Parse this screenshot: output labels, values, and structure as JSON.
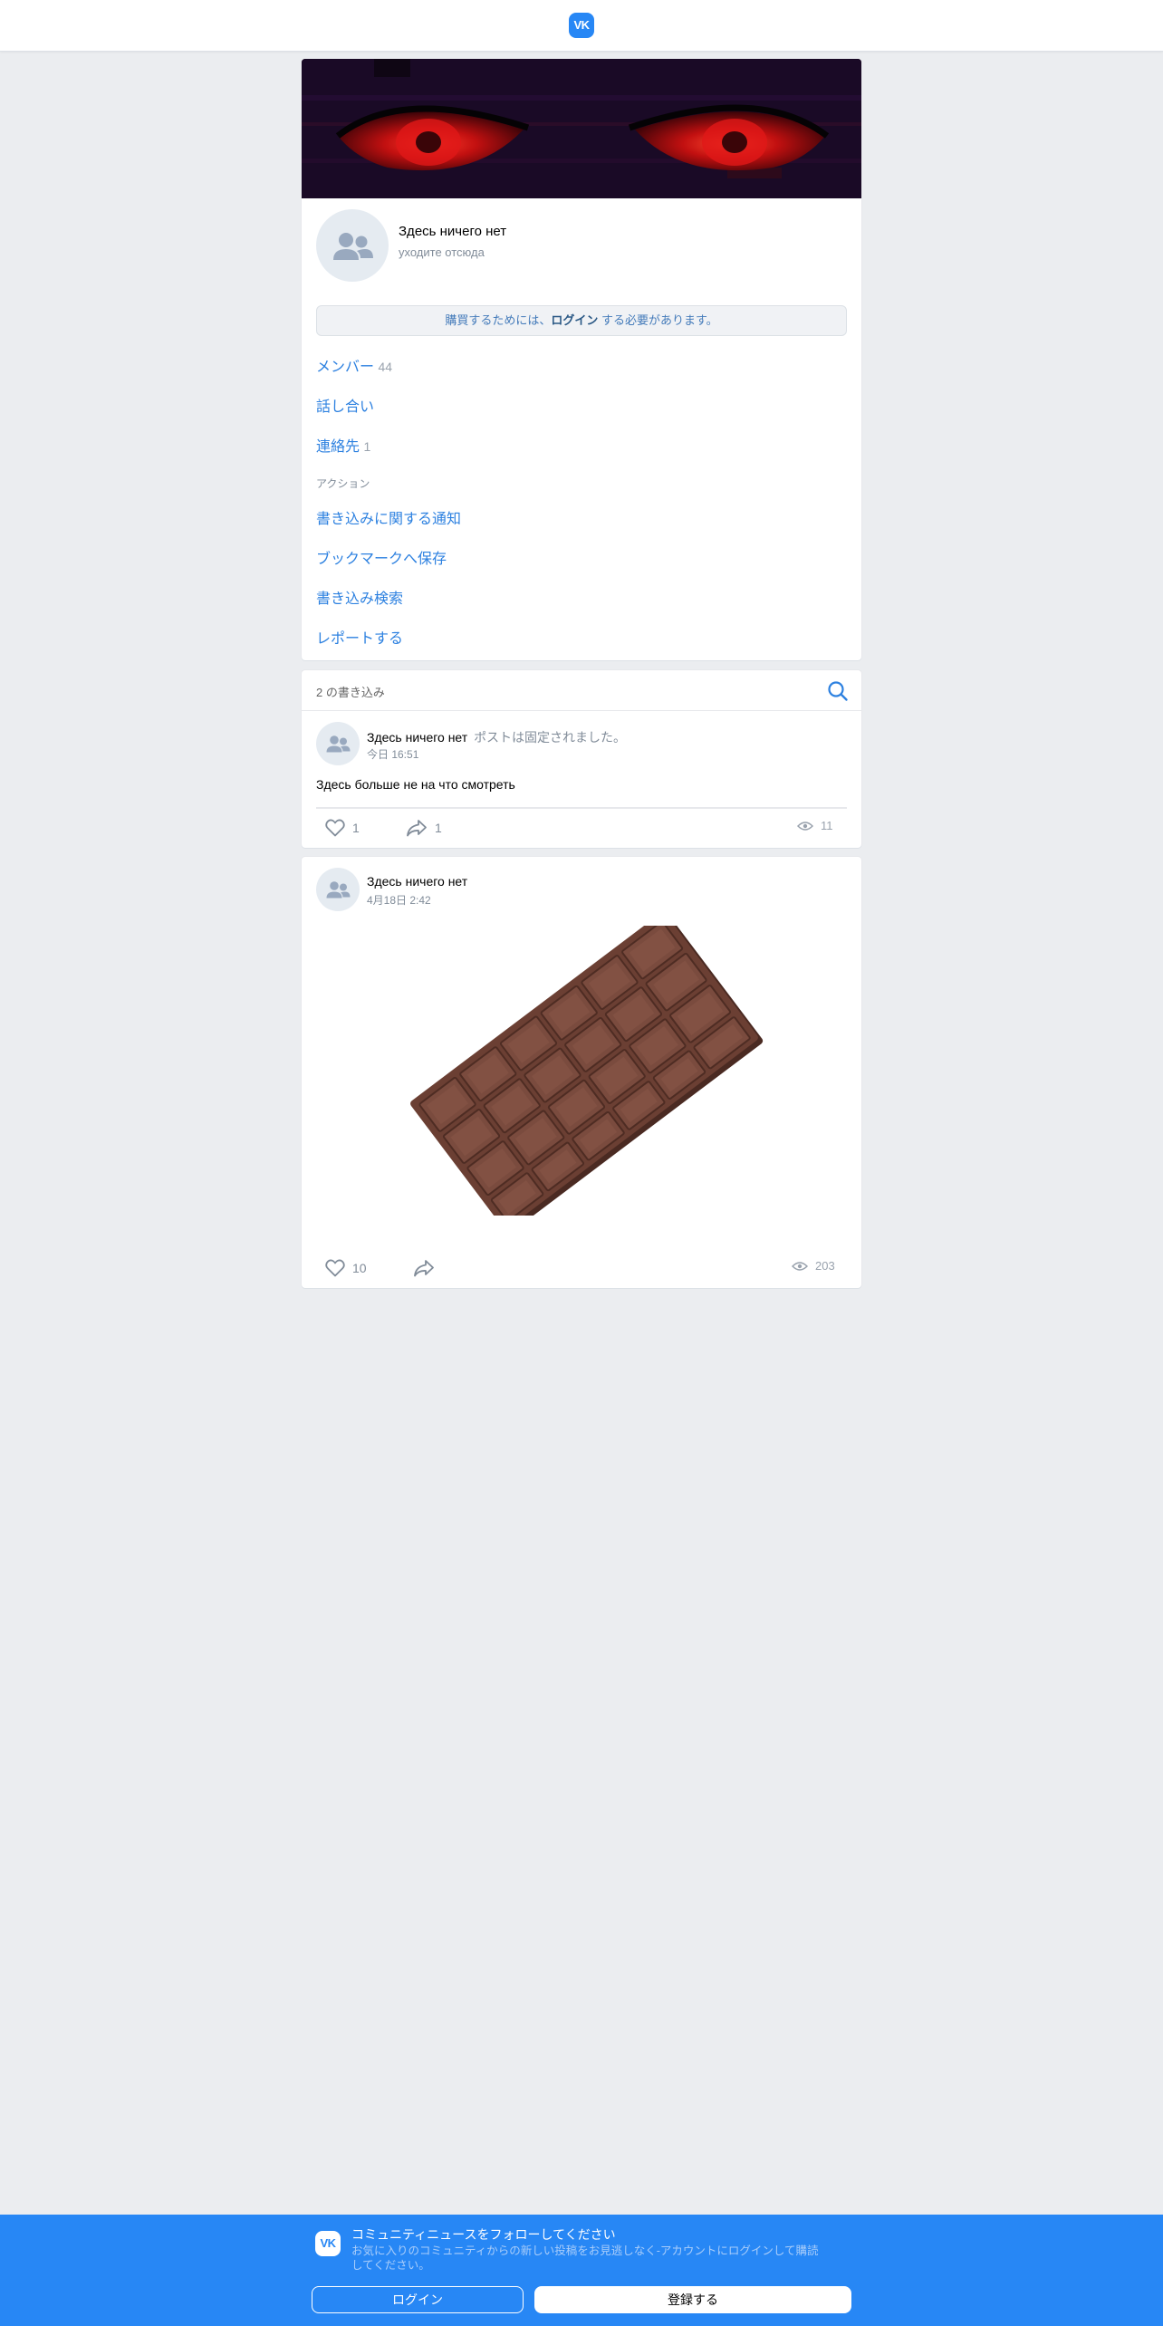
{
  "header": {
    "logo_text": "VK",
    "logo_color": "#2787f5"
  },
  "group": {
    "name": "Здесь ничего нет",
    "status": "уходите отсюда",
    "subscribe_note": {
      "prefix": "購買するためには、",
      "login": "ログイン",
      "suffix": " する必要があります。"
    },
    "links": [
      {
        "label": "メンバー",
        "count": "44"
      },
      {
        "label": "話し合い",
        "count": ""
      },
      {
        "label": "連絡先",
        "count": "1"
      }
    ],
    "actions_title": "アクション",
    "actions": [
      "書き込みに関する通知",
      "ブックマークへ保存",
      "書き込み検索",
      "レポートする"
    ]
  },
  "wall": {
    "count_label": "2 の書き込み",
    "posts": [
      {
        "author": "Здесь ничего нет",
        "pinned": "ポストは固定されました。",
        "date": "今日 16:51",
        "text": "Здесь больше не на что смотреть",
        "likes": "1",
        "shares": "1",
        "views": "11"
      },
      {
        "author": "Здесь ничего нет",
        "date": "4月18日 2:42",
        "likes": "10",
        "shares": "",
        "views": "203"
      }
    ]
  },
  "banner": {
    "title": "コミュニティニュースをフォローしてください",
    "subtitle": "お気に入りのコミュニティからの新しい投稿をお見逃しなく-アカウントにログインして購読してください。",
    "login_label": "ログイン",
    "register_label": "登録する",
    "color": "#2787f5"
  }
}
